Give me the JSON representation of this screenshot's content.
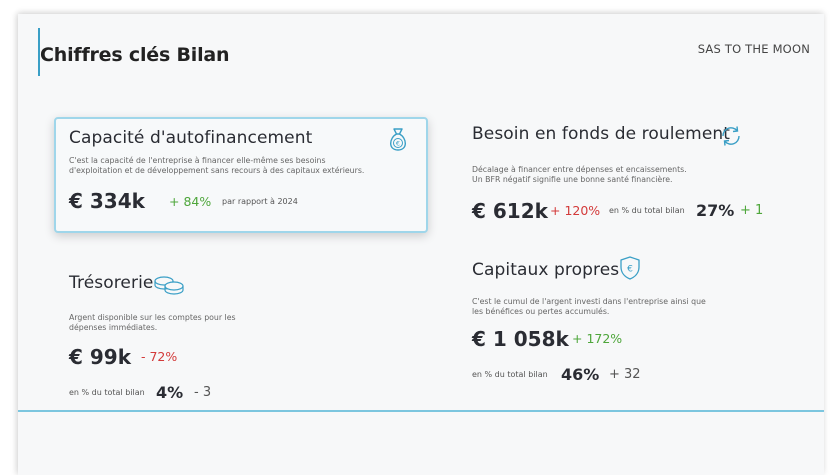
{
  "header": {
    "title": "Chiffres clés Bilan",
    "company": "SAS TO THE MOON"
  },
  "cards": {
    "caf": {
      "title": "Capacité d'autofinancement",
      "description_line1": "C'est la capacité de l'entreprise à financer elle-même ses besoins",
      "description_line2": "d'exploitation et de développement sans recours à des capitaux extérieurs.",
      "value": "€ 334k",
      "delta": "+ 84%",
      "delta_note": "par rapport à 2024",
      "icon": "money-bag-icon"
    },
    "bfr": {
      "title": "Besoin en fonds de roulement",
      "description_line1": "Décalage à financer entre dépenses et encaissements.",
      "description_line2": "Un BFR négatif signifie une bonne santé financière.",
      "value": "€ 612k",
      "delta": "+ 120%",
      "pct_label": "en % du total bilan",
      "pct": "27%",
      "pct_delta": "+ 1",
      "icon": "refresh-cycle-icon"
    },
    "tresorerie": {
      "title": "Trésorerie",
      "description_line1": "Argent disponible sur les comptes pour les",
      "description_line2": "dépenses immédiates.",
      "value": "€ 99k",
      "delta": "- 72%",
      "pct_label": "en % du total bilan",
      "pct": "4%",
      "pct_delta": "- 3",
      "icon": "coins-icon"
    },
    "capitaux": {
      "title": "Capitaux propres",
      "description_line1": "C'est le cumul de l'argent investi dans l'entreprise ainsi que",
      "description_line2": "les bénéfices ou pertes accumulés.",
      "value": "€ 1 058k",
      "delta": "+ 172%",
      "pct_label": "en % du total bilan",
      "pct": "46%",
      "pct_delta": "+ 32",
      "icon": "euro-shield-icon"
    }
  },
  "colors": {
    "accent": "#3a9fc6",
    "positive": "#4ea63b",
    "negative": "#d33a3a",
    "card_border": "#9fd6ea"
  }
}
